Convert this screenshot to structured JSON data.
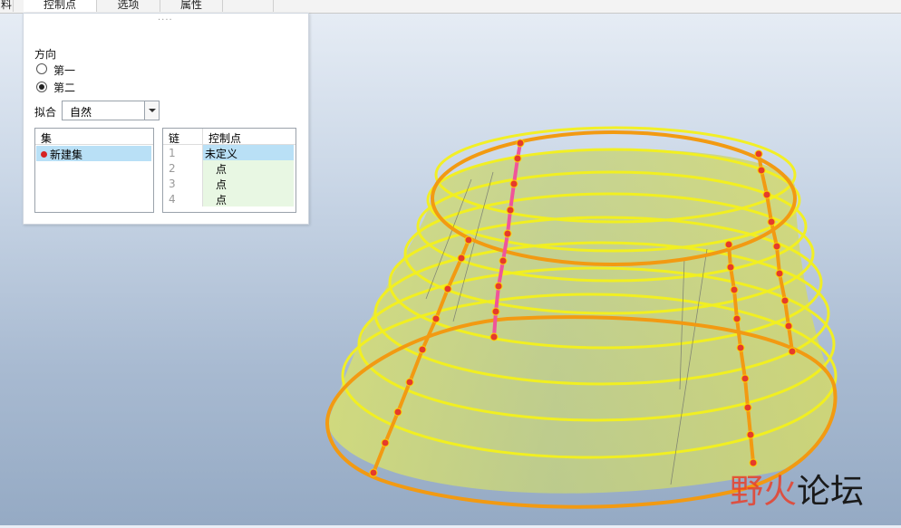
{
  "tabs": [
    {
      "label": "料"
    },
    {
      "label": "控制点"
    },
    {
      "label": "选项"
    },
    {
      "label": "属性"
    },
    {
      "label": ""
    }
  ],
  "panel": {
    "grip": "····",
    "direction_label": "方向",
    "direction_options": [
      {
        "label": "第一",
        "checked": false
      },
      {
        "label": "第二",
        "checked": true
      }
    ],
    "fit_label": "拟合",
    "fit_value": "自然",
    "set_list": {
      "header": "集",
      "items": [
        {
          "label": "新建集",
          "selected": true
        }
      ]
    },
    "chain_table": {
      "headers": [
        "链",
        "控制点"
      ],
      "rows": [
        {
          "n": "1",
          "v": "未定义"
        },
        {
          "n": "2",
          "v": "点"
        },
        {
          "n": "3",
          "v": "点"
        },
        {
          "n": "4",
          "v": "点"
        }
      ]
    }
  },
  "watermark": {
    "part1": "野火",
    "part2": "论坛"
  },
  "colors": {
    "surface": "#cfe06a",
    "ring": "#f4f11c",
    "edge": "#f29a12",
    "highlight_chain": "#f0549a",
    "point": "#e53b2b"
  }
}
